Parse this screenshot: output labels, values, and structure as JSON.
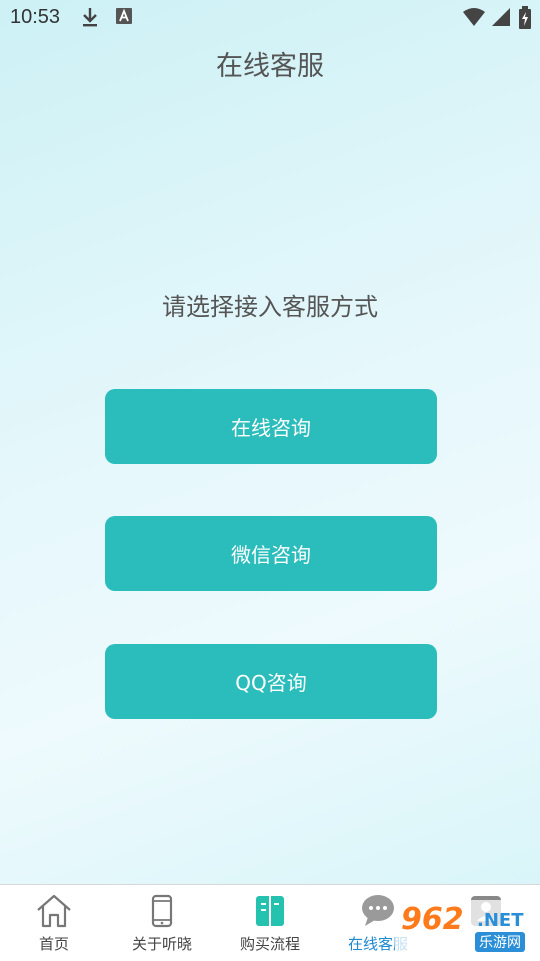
{
  "status_bar": {
    "time": "10:53"
  },
  "header": {
    "title": "在线客服"
  },
  "main": {
    "prompt": "请选择接入客服方式",
    "buttons": [
      {
        "label": "在线咨询"
      },
      {
        "label": "微信咨询"
      },
      {
        "label": "QQ咨询"
      }
    ]
  },
  "tabbar": {
    "tabs": [
      {
        "label": "首页",
        "icon": "home-icon",
        "active": false
      },
      {
        "label": "关于听晓",
        "icon": "phone-icon",
        "active": false
      },
      {
        "label": "购买流程",
        "icon": "book-icon",
        "active": false
      },
      {
        "label": "在线客服",
        "icon": "chat-icon",
        "active": true
      },
      {
        "label": "",
        "icon": "profile-icon",
        "active": false
      }
    ],
    "active_color": "#1e88d0"
  },
  "watermark": {
    "logo": "962",
    "suffix": ".NET",
    "sub": "乐游网"
  },
  "colors": {
    "button": "#2bbcbc",
    "title_text": "#555555"
  }
}
